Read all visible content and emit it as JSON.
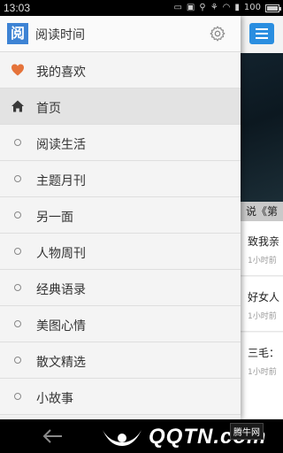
{
  "status": {
    "time": "13:03",
    "battery": "100"
  },
  "drawer": {
    "title": "阅读时间",
    "logo_glyph": "阅",
    "items": [
      {
        "label": "我的喜欢",
        "icon": "heart-icon"
      },
      {
        "label": "首页",
        "icon": "home-icon",
        "active": true
      },
      {
        "label": "阅读生活",
        "icon": "dot-icon"
      },
      {
        "label": "主题月刊",
        "icon": "dot-icon"
      },
      {
        "label": "另一面",
        "icon": "dot-icon"
      },
      {
        "label": "人物周刊",
        "icon": "dot-icon"
      },
      {
        "label": "经典语录",
        "icon": "dot-icon"
      },
      {
        "label": "美图心情",
        "icon": "dot-icon"
      },
      {
        "label": "散文精选",
        "icon": "dot-icon"
      },
      {
        "label": "小故事",
        "icon": "dot-icon"
      }
    ]
  },
  "content": {
    "hero_caption": "说《第",
    "articles": [
      {
        "title": "致我亲",
        "time": "1小时前"
      },
      {
        "title": "好女人",
        "time": "1小时前"
      },
      {
        "title": "三毛：",
        "time": "1小时前"
      }
    ]
  },
  "watermark": {
    "text": "QQTN.com",
    "site": "腾牛网"
  },
  "colors": {
    "accent": "#2a8ee0",
    "heart": "#e5733a",
    "logo": "#3d83d4"
  }
}
